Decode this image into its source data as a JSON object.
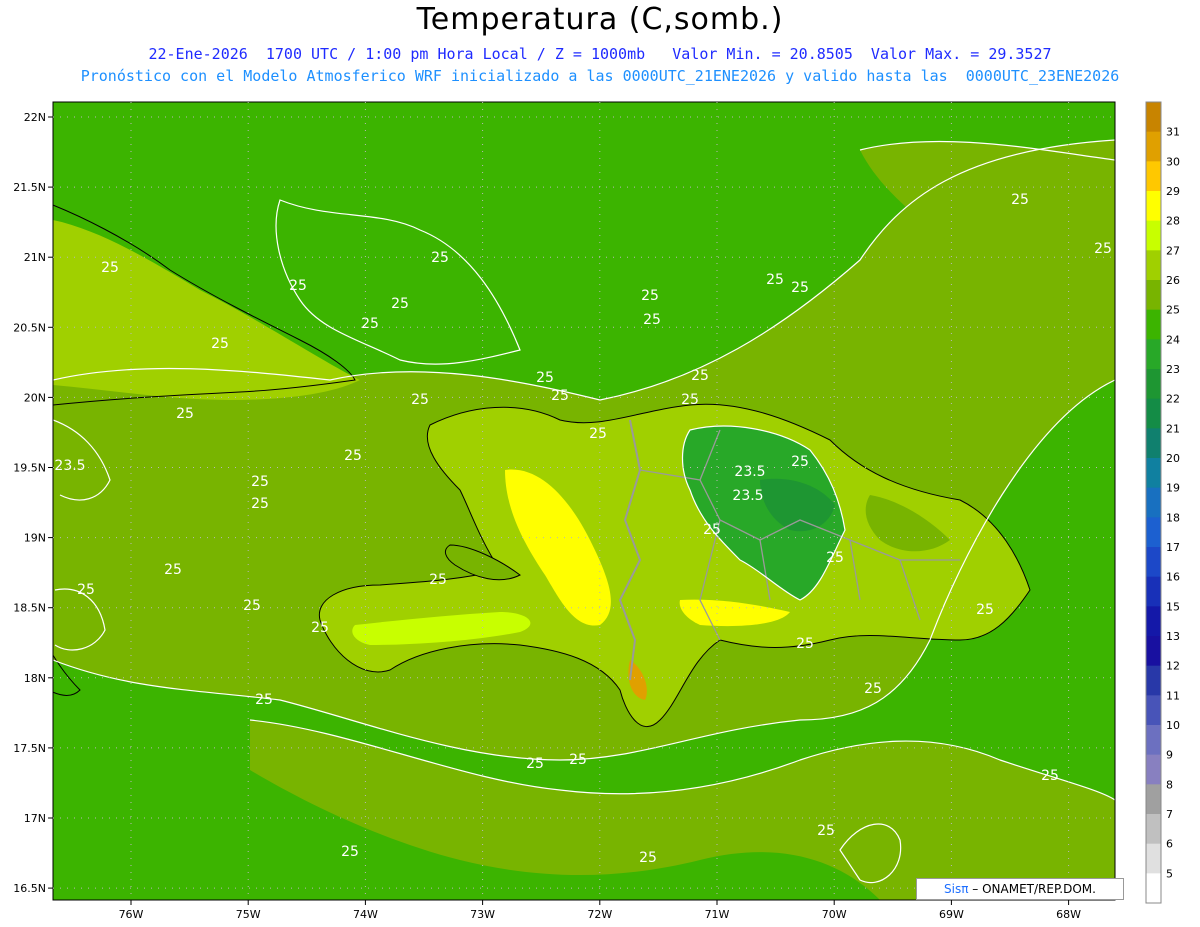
{
  "title": "Temperatura (C,somb.)",
  "subtitle_line1": "22-Ene-2026  1700 UTC / 1:00 pm Hora Local / Z = 1000mb   Valor Min. = 20.8505  Valor Max. = 29.3527",
  "subtitle_line2": "Pronóstico con el Modelo Atmosferico WRF inicializado a las 0000UTC_21ENE2026 y valido hasta las  0000UTC_23ENE2026",
  "axes": {
    "lat_ticks": [
      "22N",
      "21.5N",
      "21N",
      "20.5N",
      "20N",
      "19.5N",
      "19N",
      "18.5N",
      "18N",
      "17.5N",
      "17N",
      "16.5N"
    ],
    "lon_ticks": [
      "76W",
      "75W",
      "74W",
      "73W",
      "72W",
      "71W",
      "70W",
      "69W",
      "68W"
    ]
  },
  "colorbar": {
    "labels": [
      "31",
      "30",
      "29",
      "28",
      "27",
      "26",
      "25",
      "24",
      "23",
      "22",
      "21",
      "20",
      "19",
      "18",
      "17",
      "16",
      "15",
      "13",
      "12",
      "11",
      "10",
      "9",
      "8",
      "7",
      "6",
      "5"
    ],
    "colors": [
      "#c88400",
      "#e0a000",
      "#ffc800",
      "#ffff00",
      "#c8ff00",
      "#a0d000",
      "#78b400",
      "#3cb400",
      "#28a828",
      "#1e9632",
      "#148c46",
      "#10806e",
      "#1080a0",
      "#1870c0",
      "#1c60d0",
      "#1c48c8",
      "#1830b8",
      "#1418a8",
      "#1810a0",
      "#2838a8",
      "#4854b8",
      "#6c70c0",
      "#8880c0",
      "#a0a0a0",
      "#c0c0c0",
      "#e0e0e0",
      "#ffffff"
    ]
  },
  "contour_labels": [
    "25",
    "25",
    "25",
    "25",
    "25",
    "25",
    "25",
    "25",
    "25",
    "25",
    "25",
    "25",
    "23.5",
    "25",
    "25",
    "25",
    "25",
    "25",
    "25",
    "25",
    "25",
    "25",
    "25",
    "23.5",
    "25",
    "23.5",
    "25",
    "25",
    "25",
    "25",
    "25",
    "25",
    "25",
    "25",
    "25",
    "25",
    "25",
    "25",
    "25",
    "25",
    "25",
    "25",
    "25"
  ],
  "credit": {
    "brand": "Sisπ",
    "text": " – ONAMET/REP.DOM."
  },
  "colors": {
    "ocean": "#3cb400",
    "land_warm": "#a0d000",
    "land_mid": "#78b400",
    "hot": "#ffff00",
    "cool": "#28a828",
    "contour": "#ffffff",
    "title": "#000000",
    "subtitle1": "#1f2bff",
    "subtitle2": "#1e90ff"
  }
}
